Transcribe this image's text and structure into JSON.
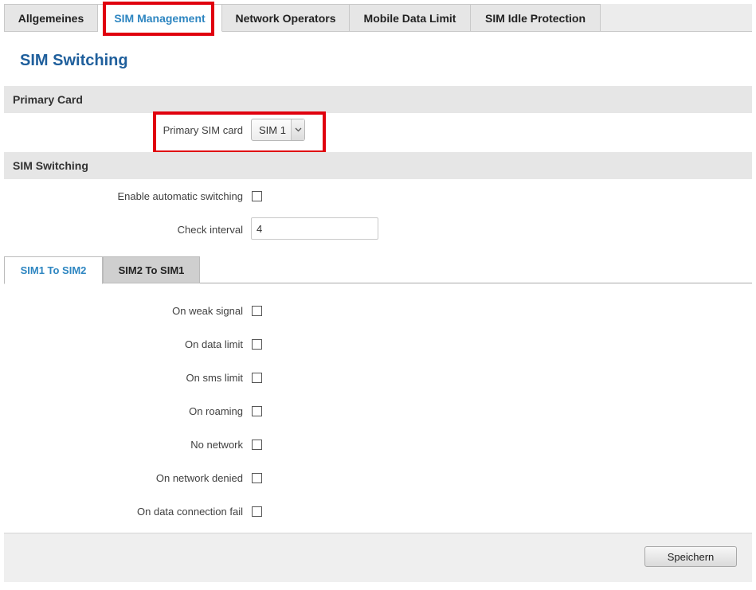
{
  "top_tabs": [
    {
      "label": "Allgemeines",
      "active": false
    },
    {
      "label": "SIM Management",
      "active": true
    },
    {
      "label": "Network Operators",
      "active": false
    },
    {
      "label": "Mobile Data Limit",
      "active": false
    },
    {
      "label": "SIM Idle Protection",
      "active": false
    }
  ],
  "page_title": "SIM Switching",
  "primary_card": {
    "header": "Primary Card",
    "primary_sim_label": "Primary SIM card",
    "primary_sim_value": "SIM 1"
  },
  "sim_switching": {
    "header": "SIM Switching",
    "auto_switch_label": "Enable automatic switching",
    "auto_switch_checked": false,
    "check_interval_label": "Check interval",
    "check_interval_value": "4"
  },
  "sub_tabs": [
    {
      "label": "SIM1 To SIM2",
      "active": true
    },
    {
      "label": "SIM2 To SIM1",
      "active": false
    }
  ],
  "conditions": [
    {
      "label": "On weak signal",
      "checked": false
    },
    {
      "label": "On data limit",
      "checked": false
    },
    {
      "label": "On sms limit",
      "checked": false
    },
    {
      "label": "On roaming",
      "checked": false
    },
    {
      "label": "No network",
      "checked": false
    },
    {
      "label": "On network denied",
      "checked": false
    },
    {
      "label": "On data connection fail",
      "checked": false
    }
  ],
  "footer": {
    "save_label": "Speichern"
  },
  "colors": {
    "accent": "#2e86c1",
    "title": "#1f5f9c",
    "highlight": "#e0000e"
  }
}
